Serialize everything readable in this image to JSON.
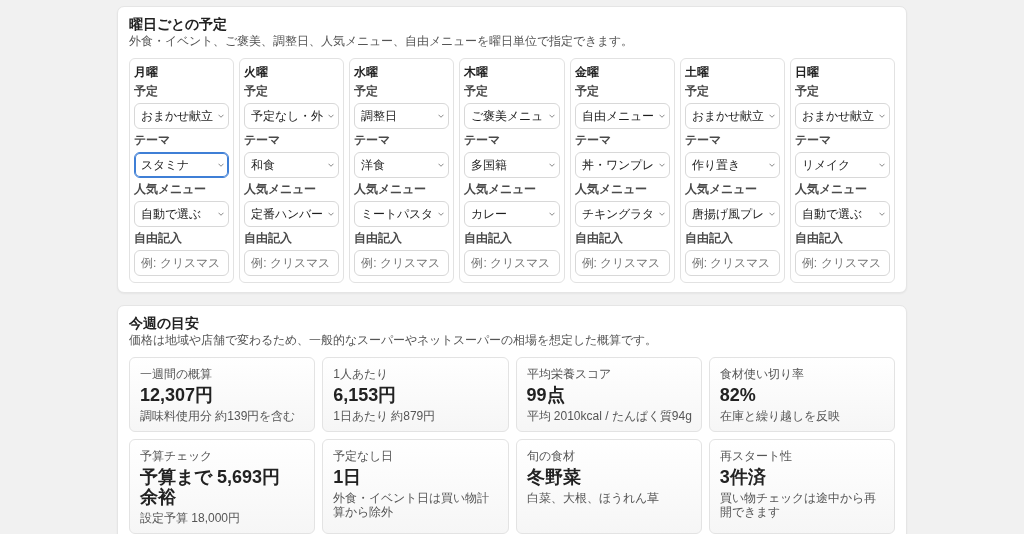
{
  "schedule": {
    "title": "曜日ごとの予定",
    "description": "外食・イベント、ご褒美、調整日、人気メニュー、自由メニューを曜日単位で指定できます。",
    "days": [
      {
        "day": "月曜",
        "fields": [
          {
            "kind": "select",
            "label": "予定",
            "value": "おまかせ献立",
            "focused": false
          },
          {
            "kind": "select",
            "label": "テーマ",
            "value": "スタミナ",
            "focused": true
          },
          {
            "kind": "select",
            "label": "人気メニュー",
            "value": "自動で選ぶ",
            "focused": false
          },
          {
            "kind": "input",
            "label": "自由記入",
            "placeholder": "例: クリスマス",
            "focused": false
          }
        ]
      },
      {
        "day": "火曜",
        "fields": [
          {
            "kind": "select",
            "label": "予定",
            "value": "予定なし・外",
            "focused": false
          },
          {
            "kind": "select",
            "label": "テーマ",
            "value": "和食",
            "focused": false
          },
          {
            "kind": "select",
            "label": "人気メニュー",
            "value": "定番ハンバー",
            "focused": false
          },
          {
            "kind": "input",
            "label": "自由記入",
            "placeholder": "例: クリスマス",
            "focused": false
          }
        ]
      },
      {
        "day": "水曜",
        "fields": [
          {
            "kind": "select",
            "label": "予定",
            "value": "調整日",
            "focused": false
          },
          {
            "kind": "select",
            "label": "テーマ",
            "value": "洋食",
            "focused": false
          },
          {
            "kind": "select",
            "label": "人気メニュー",
            "value": "ミートパスタ",
            "focused": false
          },
          {
            "kind": "input",
            "label": "自由記入",
            "placeholder": "例: クリスマス",
            "focused": false
          }
        ]
      },
      {
        "day": "木曜",
        "fields": [
          {
            "kind": "select",
            "label": "予定",
            "value": "ご褒美メニュ",
            "focused": false
          },
          {
            "kind": "select",
            "label": "テーマ",
            "value": "多国籍",
            "focused": false
          },
          {
            "kind": "select",
            "label": "人気メニュー",
            "value": "カレー",
            "focused": false
          },
          {
            "kind": "input",
            "label": "自由記入",
            "placeholder": "例: クリスマス",
            "focused": false
          }
        ]
      },
      {
        "day": "金曜",
        "fields": [
          {
            "kind": "select",
            "label": "予定",
            "value": "自由メニュー",
            "focused": false
          },
          {
            "kind": "select",
            "label": "テーマ",
            "value": "丼・ワンプレ",
            "focused": false
          },
          {
            "kind": "select",
            "label": "人気メニュー",
            "value": "チキングラタ",
            "focused": false
          },
          {
            "kind": "input",
            "label": "自由記入",
            "placeholder": "例: クリスマス",
            "focused": false
          }
        ]
      },
      {
        "day": "土曜",
        "fields": [
          {
            "kind": "select",
            "label": "予定",
            "value": "おまかせ献立",
            "focused": false
          },
          {
            "kind": "select",
            "label": "テーマ",
            "value": "作り置き",
            "focused": false
          },
          {
            "kind": "select",
            "label": "人気メニュー",
            "value": "唐揚げ風プレ",
            "focused": false
          },
          {
            "kind": "input",
            "label": "自由記入",
            "placeholder": "例: クリスマス",
            "focused": false
          }
        ]
      },
      {
        "day": "日曜",
        "fields": [
          {
            "kind": "select",
            "label": "予定",
            "value": "おまかせ献立",
            "focused": false
          },
          {
            "kind": "select",
            "label": "テーマ",
            "value": "リメイク",
            "focused": false
          },
          {
            "kind": "select",
            "label": "人気メニュー",
            "value": "自動で選ぶ",
            "focused": false
          },
          {
            "kind": "input",
            "label": "自由記入",
            "placeholder": "例: クリスマス",
            "focused": false
          }
        ]
      }
    ]
  },
  "summary": {
    "title": "今週の目安",
    "description": "価格は地域や店舗で変わるため、一般的なスーパーやネットスーパーの相場を想定した概算です。",
    "stats": [
      {
        "label": "一週間の概算",
        "value": "12,307円",
        "note": "調味料使用分 約139円を含む"
      },
      {
        "label": "1人あたり",
        "value": "6,153円",
        "note": "1日あたり 約879円"
      },
      {
        "label": "平均栄養スコア",
        "value": "99点",
        "note": "平均 2010kcal / たんぱく質94g"
      },
      {
        "label": "食材使い切り率",
        "value": "82%",
        "note": "在庫と繰り越しを反映"
      },
      {
        "label": "予算チェック",
        "value": "予算まで 5,693円余裕",
        "note": "設定予算 18,000円"
      },
      {
        "label": "予定なし日",
        "value": "1日",
        "note": "外食・イベント日は買い物計算から除外"
      },
      {
        "label": "旬の食材",
        "value": "冬野菜",
        "note": "白菜、大根、ほうれん草"
      },
      {
        "label": "再スタート性",
        "value": "3件済",
        "note": "買い物チェックは途中から再開できます"
      }
    ]
  }
}
